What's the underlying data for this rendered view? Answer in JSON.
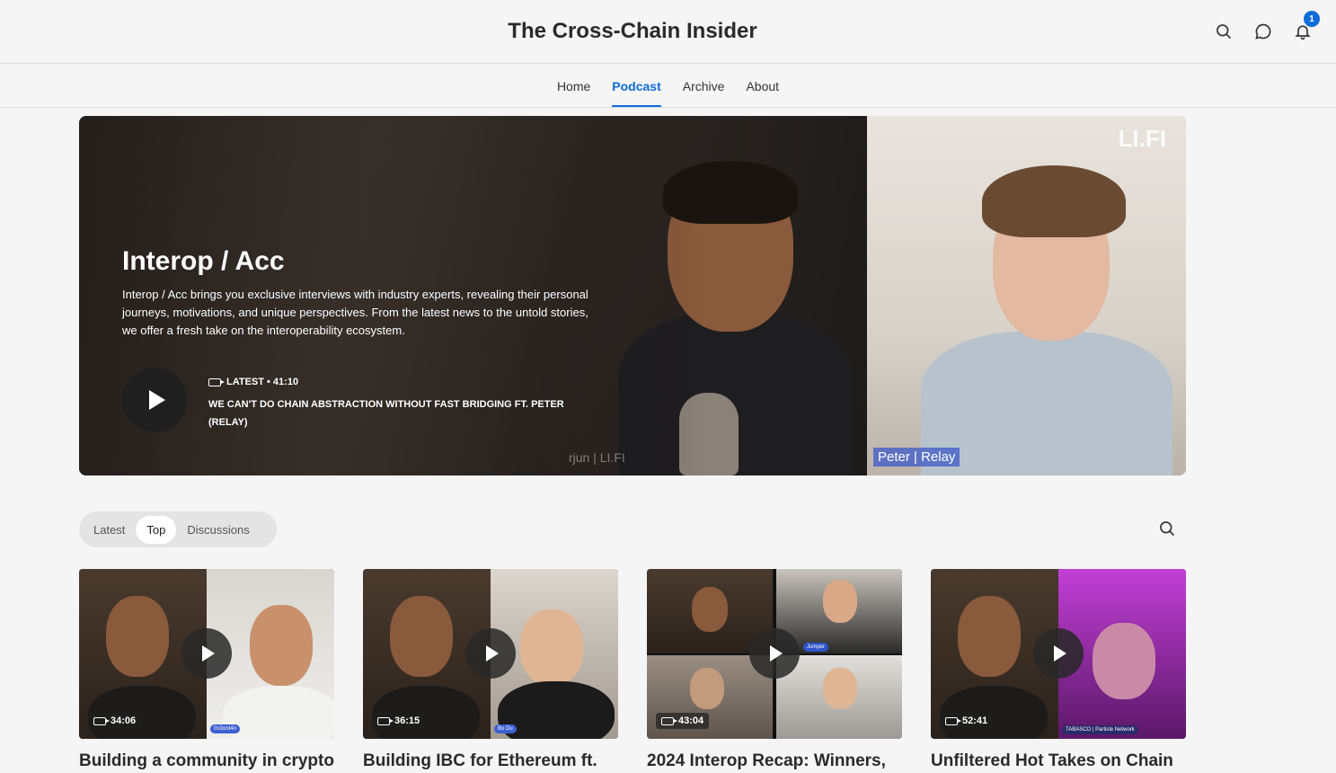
{
  "header": {
    "site_title": "The Cross-Chain Insider",
    "notification_count": "1"
  },
  "nav": {
    "tabs": [
      {
        "label": "Home"
      },
      {
        "label": "Podcast"
      },
      {
        "label": "Archive"
      },
      {
        "label": "About"
      }
    ],
    "active": "Podcast"
  },
  "hero": {
    "title": "Interop / Acc",
    "description": "Interop / Acc brings you exclusive interviews with industry experts, revealing their personal journeys, motivations, and unique perspectives. From the latest news to the untold stories, we offer a fresh take on the interoperability ecosystem.",
    "meta": "LATEST • 41:10",
    "episode_title": "We can't do chain abstraction without fast bridging ft. Peter (Relay)",
    "logo_text": "LI.FI",
    "name_tag_left": "rjun | LI.FI",
    "name_tag_right": "Peter | Relay"
  },
  "filters": {
    "tabs": [
      {
        "label": "Latest"
      },
      {
        "label": "Top"
      },
      {
        "label": "Discussions"
      }
    ],
    "active": "Top"
  },
  "episodes": [
    {
      "title": "Building a community in crypto",
      "duration": "34:06",
      "tag": "0x3ord4n"
    },
    {
      "title": "Building IBC for Ethereum ft.",
      "duration": "36:15",
      "tag": "Bo Du"
    },
    {
      "title": "2024 Interop Recap: Winners,",
      "duration": "43:04",
      "tag": "Jumper"
    },
    {
      "title": "Unfiltered Hot Takes on Chain",
      "duration": "52:41",
      "tag": "TABASCO | Particle Network"
    }
  ],
  "colors": {
    "accent": "#0f6bd8",
    "background": "#f5f5f5"
  },
  "icons": [
    "search-icon",
    "chat-icon",
    "bell-icon",
    "play-icon",
    "video-camera-icon"
  ]
}
